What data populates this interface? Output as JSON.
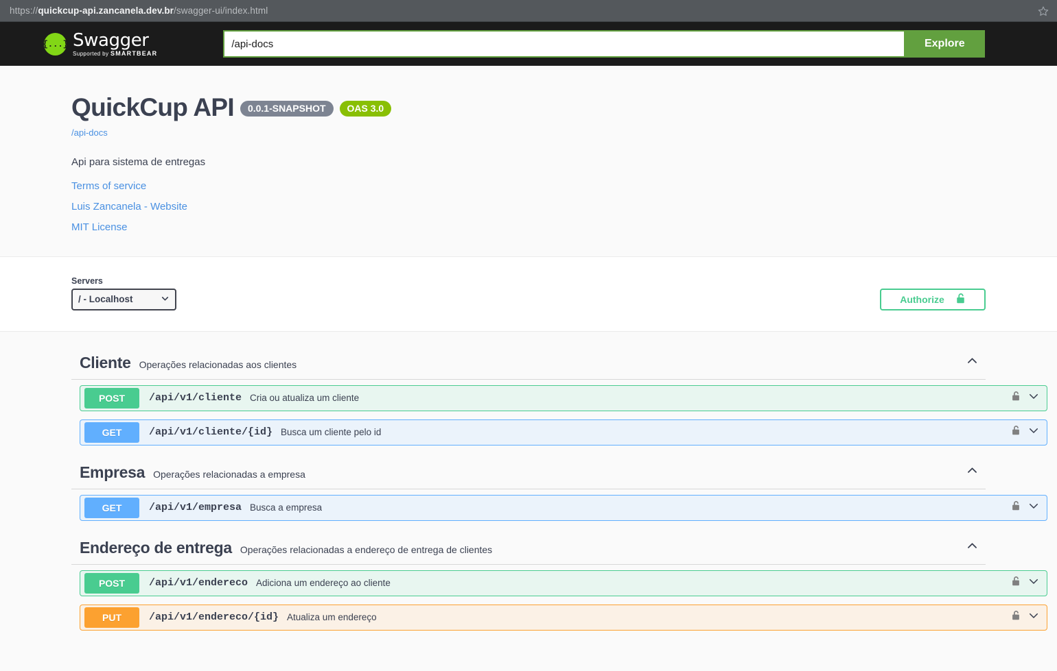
{
  "browser": {
    "url_scheme": "https://",
    "url_host": "quickcup-api.zancanela.dev.br",
    "url_path": "/swagger-ui/index.html",
    "bookmark_icon": "star-outline-icon"
  },
  "topbar": {
    "logo_glyph": "{...}",
    "logo_title": "Swagger",
    "logo_supported_prefix": "Supported by",
    "logo_supported_brand": "SMARTBEAR",
    "spec_url_value": "/api-docs",
    "spec_url_placeholder": "/api-docs",
    "explore_label": "Explore"
  },
  "info": {
    "title": "QuickCup API",
    "version_badge": "0.0.1-SNAPSHOT",
    "oas_badge": "OAS 3.0",
    "spec_link": "/api-docs",
    "description": "Api para sistema de entregas",
    "links": [
      {
        "label": "Terms of service"
      },
      {
        "label": "Luis Zancanela - Website"
      },
      {
        "label": "MIT License"
      }
    ]
  },
  "servers": {
    "label": "Servers",
    "selected": "/ - Localhost",
    "options": [
      "/ - Localhost"
    ],
    "chevron_icon": "chevron-down-icon"
  },
  "authorize": {
    "label": "Authorize",
    "lock_icon": "unlocked-padlock-icon",
    "accent_color": "#49cc90"
  },
  "tags": [
    {
      "name": "Cliente",
      "description": "Operações relacionadas aos clientes",
      "expanded": true,
      "arrow_icon": "chevron-up-icon",
      "operations": [
        {
          "method": "POST",
          "method_class": "post",
          "path": "/api/v1/cliente",
          "summary": "Cria ou atualiza um cliente",
          "lock_icon": "unlocked-padlock-icon",
          "expand_icon": "chevron-down-icon"
        },
        {
          "method": "GET",
          "method_class": "get",
          "path": "/api/v1/cliente/{id}",
          "summary": "Busca um cliente pelo id",
          "lock_icon": "unlocked-padlock-icon",
          "expand_icon": "chevron-down-icon"
        }
      ]
    },
    {
      "name": "Empresa",
      "description": "Operações relacionadas a empresa",
      "expanded": true,
      "arrow_icon": "chevron-up-icon",
      "operations": [
        {
          "method": "GET",
          "method_class": "get",
          "path": "/api/v1/empresa",
          "summary": "Busca a empresa",
          "lock_icon": "unlocked-padlock-icon",
          "expand_icon": "chevron-down-icon"
        }
      ]
    },
    {
      "name": "Endereço de entrega",
      "description": "Operações relacionadas a endereço de entrega de clientes",
      "expanded": true,
      "arrow_icon": "chevron-up-icon",
      "operations": [
        {
          "method": "POST",
          "method_class": "post",
          "path": "/api/v1/endereco",
          "summary": "Adiciona um endereço ao cliente",
          "lock_icon": "unlocked-padlock-icon",
          "expand_icon": "chevron-down-icon"
        },
        {
          "method": "PUT",
          "method_class": "put",
          "path": "/api/v1/endereco/{id}",
          "summary": "Atualiza um endereço",
          "lock_icon": "unlocked-padlock-icon",
          "expand_icon": "chevron-down-icon"
        }
      ]
    }
  ],
  "colors": {
    "post": "#49cc90",
    "get": "#61affe",
    "put": "#fca130",
    "oas": "#89bf04",
    "version": "#7d8492",
    "explore": "#62a03f"
  }
}
